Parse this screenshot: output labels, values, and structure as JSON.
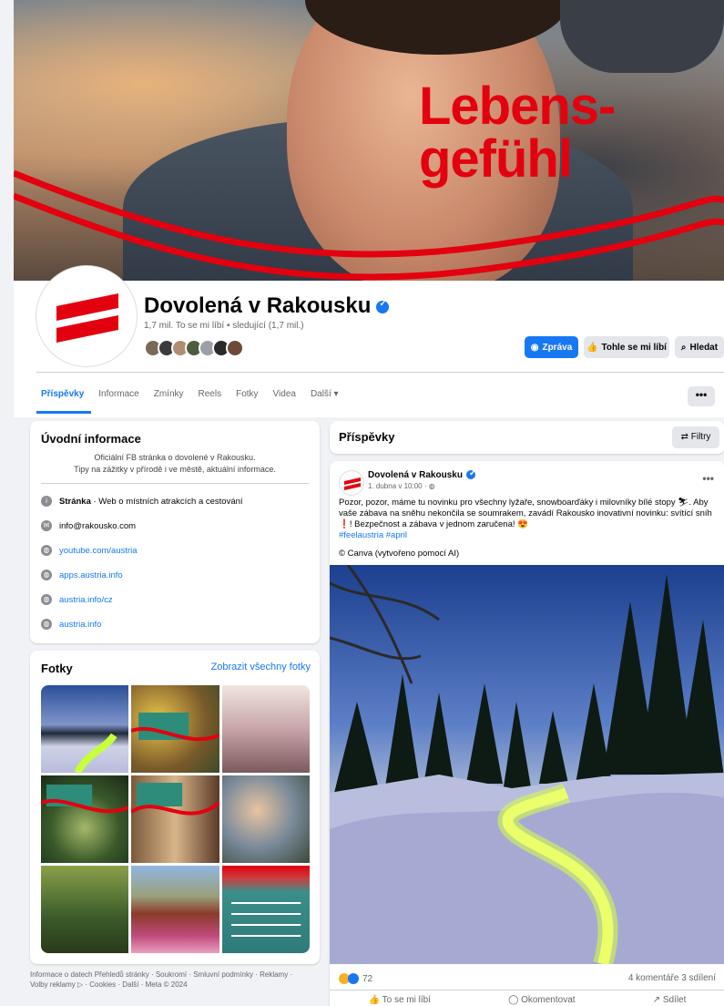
{
  "cover": {
    "overlay_text": "Lebens-\ngefühl"
  },
  "page": {
    "name": "Dovolená v Rakousku",
    "stats": "1,7 mil. To se mi líbí • sledující (1,7 mil.)"
  },
  "header_buttons": {
    "message": "Zpráva",
    "like": "Tohle se mi líbí",
    "search": "Hledat"
  },
  "tabs": [
    {
      "label": "Příspěvky"
    },
    {
      "label": "Informace"
    },
    {
      "label": "Zmínky"
    },
    {
      "label": "Reels"
    },
    {
      "label": "Fotky"
    },
    {
      "label": "Videa"
    },
    {
      "label": "Další ▾"
    }
  ],
  "more_label": "•••",
  "intro": {
    "title": "Úvodní informace",
    "bio_line1": "Oficiální FB stránka o dovolené v Rakousku.",
    "bio_line2": "Tipy na zážitky v přírodě i ve městě, aktuální informace.",
    "rows": [
      {
        "bold": "Stránka",
        "text": " · Web o místních atrakcích a cestování",
        "icon": "info-icon",
        "link": false
      },
      {
        "text": "info@rakousko.com",
        "icon": "mail-icon",
        "link": false
      },
      {
        "text": "youtube.com/austria",
        "icon": "globe-icon",
        "link": true
      },
      {
        "text": "apps.austria.info",
        "icon": "globe-icon",
        "link": true
      },
      {
        "text": "austria.info/cz",
        "icon": "globe-icon",
        "link": true
      },
      {
        "text": "austria.info",
        "icon": "globe-icon",
        "link": true
      }
    ]
  },
  "photos": {
    "title": "Fotky",
    "see_all": "Zobrazit všechny fotky"
  },
  "footer": "Informace o datech Přehledů stránky · Soukromí · Smluvní podmínky · Reklamy · Volby reklamy ▷ · Cookies · Další · Meta © 2024",
  "posts": {
    "title": "Příspěvky",
    "filters": "⇄ Filtry"
  },
  "post": {
    "author": "Dovolená v Rakousku",
    "date": "1. dubna v 10:00 · ◍",
    "text": "Pozor, pozor, máme tu novinku pro všechny lyžaře, snowboarďáky i milovníky bílé stopy ⛷. Aby vaše zábava na sněhu nekončila se soumrakem, zavádí Rakousko inovativní novinku: svítící sníh ❗! Bezpečnost a zábava v jednom zaručena! 😍",
    "tags": "#feelaustria #april",
    "credit": "© Canva (vytvořeno pomocí AI)",
    "reaction_count": "72",
    "counts": "4 komentáře   3 sdílení",
    "like": "To se mi líbí",
    "comment": "Okomentovat",
    "share": "Sdílet"
  }
}
